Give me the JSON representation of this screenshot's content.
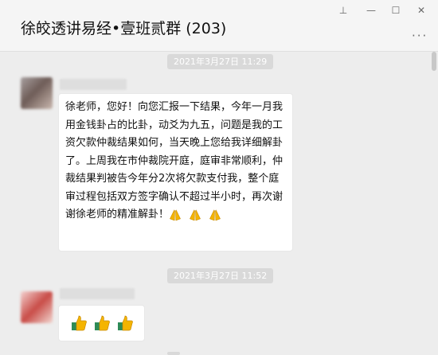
{
  "window": {
    "title": "徐皎透讲易经•壹班贰群 (203)",
    "controls": {
      "pin": "⊥",
      "minimize": "—",
      "maximize": "☐",
      "close": "✕",
      "more": "···"
    }
  },
  "messages": [
    {
      "timestamp": "2021年3月27日 11:29",
      "text": "徐老师，您好！向您汇报一下结果，今年一月我用金钱卦占的比卦，动爻为九五，问题是我的工资欠款仲裁结果如何，当天晚上您给我详细解卦了。上周我在市仲裁院开庭，庭审非常顺利，仲裁结果判被告今年分2次将欠款支付我，整个庭审过程包括双方签字确认不超过半小时，再次谢谢徐老师的精准解卦！",
      "trailing_emojis": [
        "pray",
        "pray",
        "pray"
      ]
    },
    {
      "timestamp": "2021年3月27日 11:52",
      "emojis": [
        "thumbs-up",
        "thumbs-up",
        "thumbs-up"
      ]
    }
  ],
  "colors": {
    "background": "#ededed",
    "bubble": "#ffffff",
    "timestamp_bg": "#d9d9d9",
    "emoji_yellow": "#f4b400",
    "thumb_sleeve": "#2e8b57"
  }
}
